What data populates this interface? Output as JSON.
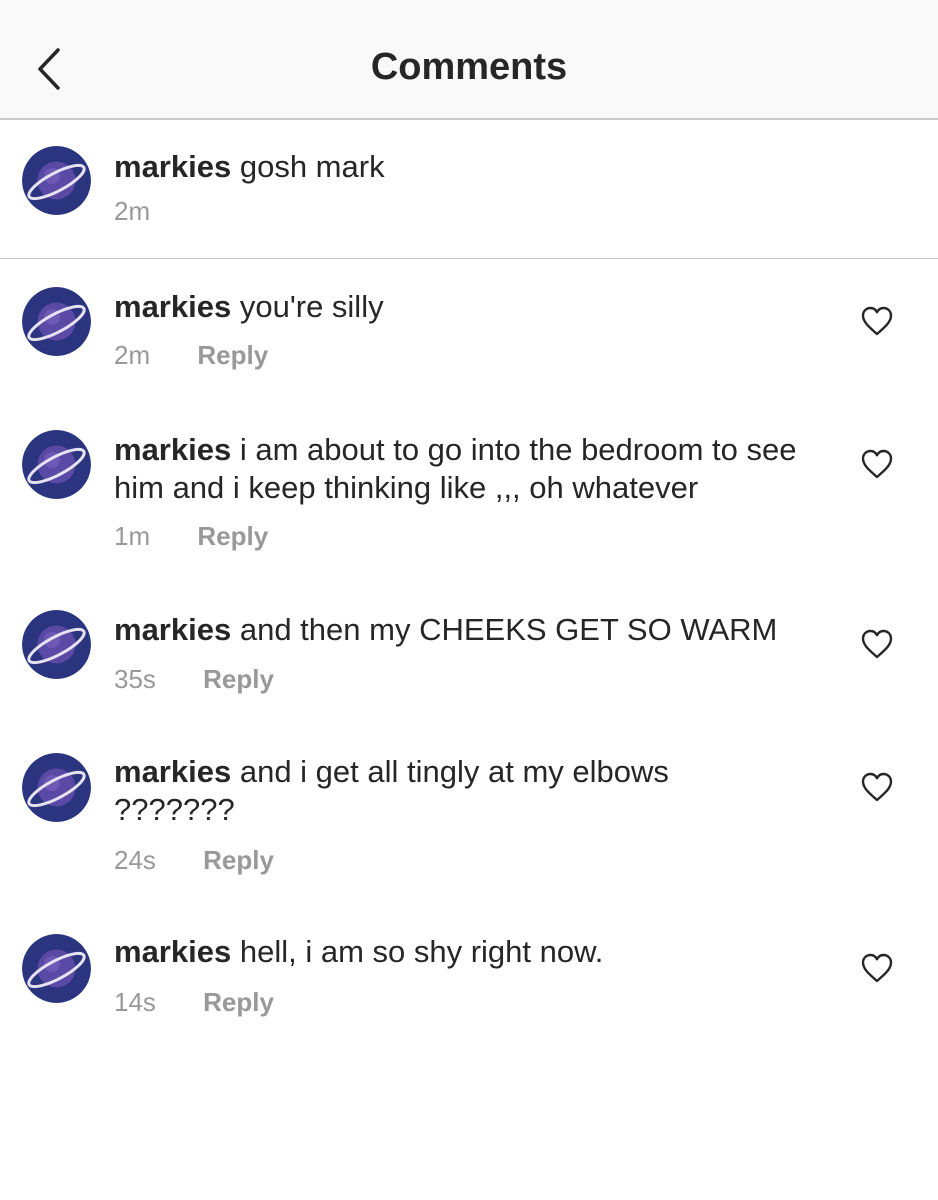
{
  "header": {
    "title": "Comments",
    "back_icon": "chevron-left-icon"
  },
  "caption": {
    "username": "markies",
    "text": "gosh mark",
    "time": "2m"
  },
  "comments": [
    {
      "username": "markies",
      "text": "you're silly",
      "time": "2m",
      "reply_label": "Reply",
      "like_icon": "heart-outline-icon"
    },
    {
      "username": "markies",
      "text": "i am about to go into the bedroom to see him and i keep thinking like ,,, oh whatever",
      "time": "1m",
      "reply_label": "Reply",
      "like_icon": "heart-outline-icon"
    },
    {
      "username": "markies",
      "text": "and then my CHEEKS GET SO WARM",
      "time": "35s",
      "reply_label": "Reply",
      "like_icon": "heart-outline-icon"
    },
    {
      "username": "markies",
      "text": "and i get all tingly at my elbows ???????",
      "time": "24s",
      "reply_label": "Reply",
      "like_icon": "heart-outline-icon"
    },
    {
      "username": "markies",
      "text": "hell, i am so shy right now.",
      "time": "14s",
      "reply_label": "Reply",
      "like_icon": "heart-outline-icon"
    }
  ],
  "colors": {
    "text": "#262626",
    "secondary": "#999999",
    "header_bg": "#f9f9f9",
    "divider": "#c8c8c8",
    "avatar_bg": "#2e3a8c"
  }
}
